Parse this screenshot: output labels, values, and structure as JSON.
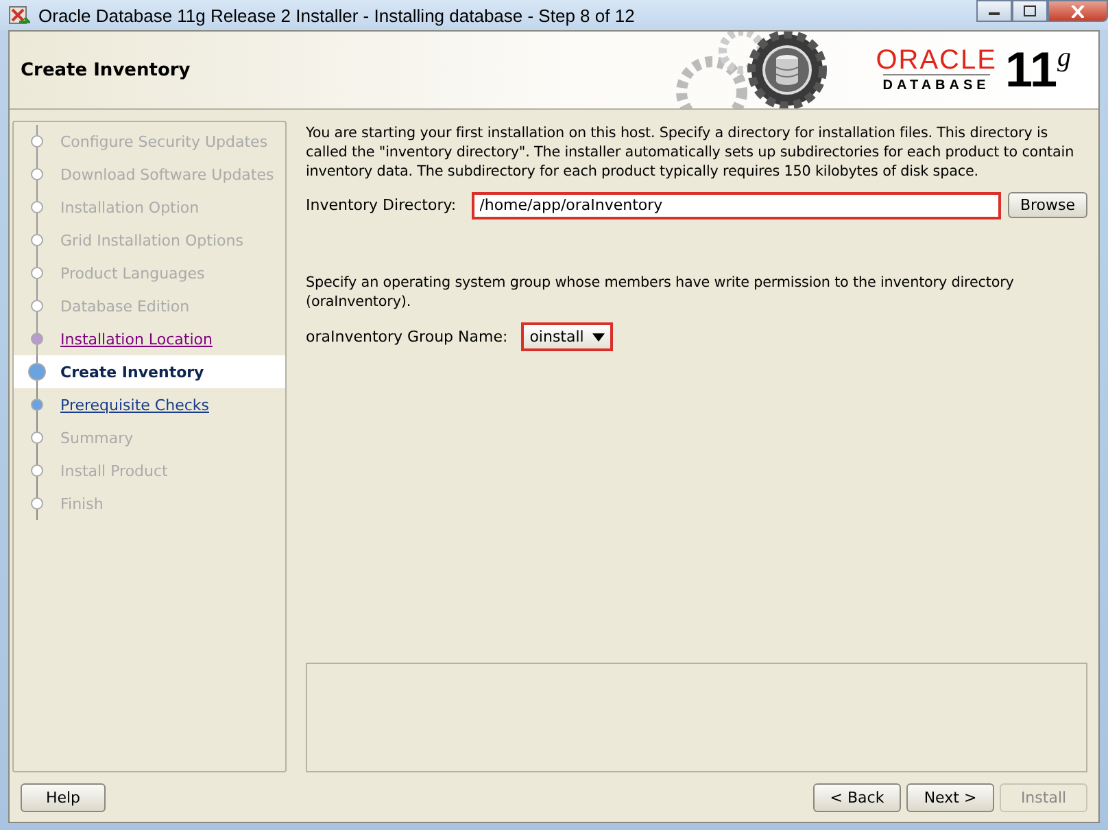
{
  "window": {
    "title": "Oracle Database 11g Release 2 Installer - Installing database - Step 8 of 12"
  },
  "header": {
    "page_title": "Create Inventory",
    "logo_brand": "ORACLE",
    "logo_product": "DATABASE",
    "logo_version": "11",
    "logo_version_suffix": "g"
  },
  "steps": [
    {
      "label": "Configure Security Updates",
      "kind": "done"
    },
    {
      "label": "Download Software Updates",
      "kind": "done"
    },
    {
      "label": "Installation Option",
      "kind": "done"
    },
    {
      "label": "Grid Installation Options",
      "kind": "done"
    },
    {
      "label": "Product Languages",
      "kind": "done"
    },
    {
      "label": "Database Edition",
      "kind": "done"
    },
    {
      "label": "Installation Location",
      "kind": "visited"
    },
    {
      "label": "Create Inventory",
      "kind": "current"
    },
    {
      "label": "Prerequisite Checks",
      "kind": "link"
    },
    {
      "label": "Summary",
      "kind": "pending"
    },
    {
      "label": "Install Product",
      "kind": "pending"
    },
    {
      "label": "Finish",
      "kind": "pending"
    }
  ],
  "intro": "You are starting your first installation on this host. Specify a directory for installation files. This directory is called the \"inventory directory\". The installer automatically sets up subdirectories for each product to contain inventory data. The subdirectory for each product typically requires 150 kilobytes of disk space.",
  "inventory_directory": {
    "label": "Inventory Directory:",
    "value": "/home/app/oraInventory",
    "browse": "Browse"
  },
  "group_intro": "Specify an operating system group whose members have write permission to the inventory directory (oraInventory).",
  "group": {
    "label": "oraInventory Group Name:",
    "value": "oinstall"
  },
  "buttons": [
    {
      "label": "Help",
      "kind": "help",
      "disabled": false
    },
    {
      "label": "< Back",
      "kind": "nav",
      "disabled": false
    },
    {
      "label": "Next >",
      "kind": "nav",
      "disabled": false
    },
    {
      "label": "Install",
      "kind": "nav",
      "disabled": true
    }
  ]
}
